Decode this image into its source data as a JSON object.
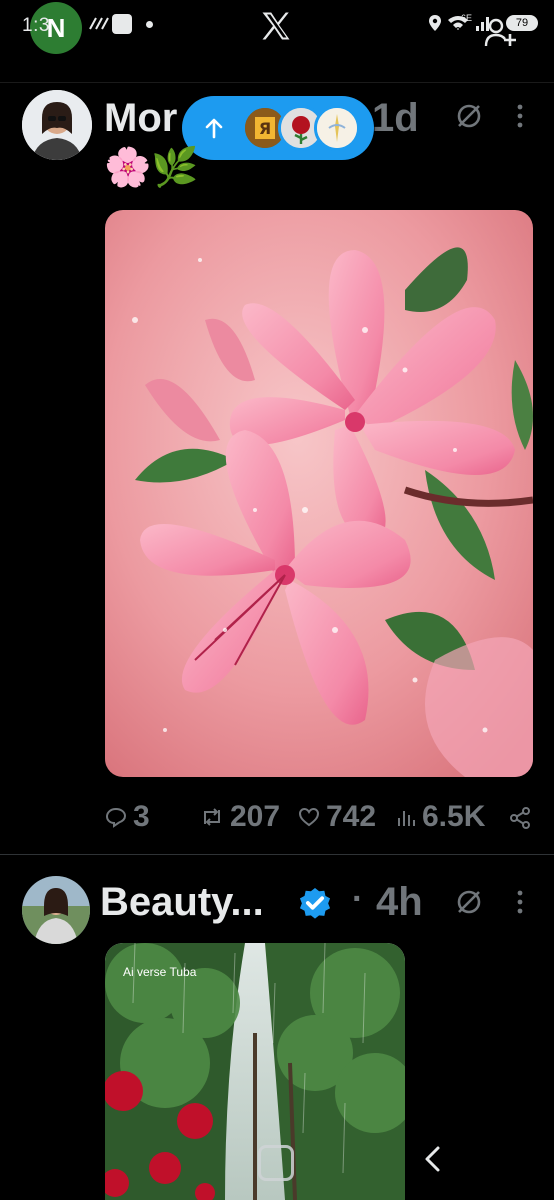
{
  "status_bar": {
    "time": "1:3",
    "notif_badge": "N",
    "network": "6E",
    "battery": "79",
    "icons": [
      "n-app-icon",
      "camera-icon",
      "samsung-notes-icon",
      "dot-icon",
      "location-icon",
      "wifi-icon",
      "signal-icon",
      "battery-icon"
    ]
  },
  "topbar": {
    "logo": "x-logo-icon",
    "add_account": "add-account-icon"
  },
  "new_posts_pill": {
    "icon": "arrow-up-icon",
    "thumbs": [
      "avatar-thumb-1",
      "avatar-thumb-2",
      "avatar-thumb-3"
    ]
  },
  "posts": [
    {
      "author_prefix": "Mor",
      "time": "1d",
      "text": "🌸🌿",
      "media_alt": "Pink lily flowers with raindrops",
      "stats": {
        "replies": "3",
        "reposts": "207",
        "likes": "742",
        "views": "6.5K"
      }
    },
    {
      "author": "Beauty...",
      "verified": true,
      "time_sep": "·",
      "time": "4h",
      "watermark": "Ai verse Tuba",
      "media_alt": "Red roses in rain along a tree-lined path"
    }
  ],
  "nav": {
    "home": "home-nav-icon",
    "back": "back-nav-icon"
  },
  "colors": {
    "accent": "#1d9bf0",
    "background": "#000000",
    "muted": "#71767b",
    "text": "#e7e9ea"
  }
}
